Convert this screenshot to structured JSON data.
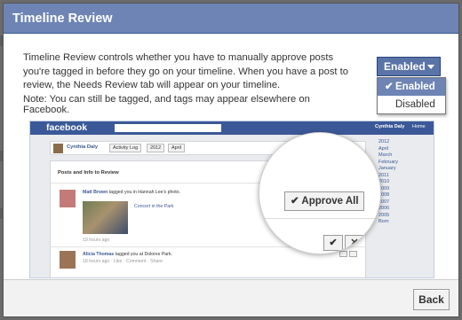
{
  "dialog": {
    "title": "Timeline Review",
    "description": "Timeline Review controls whether you have to manually approve posts you're tagged in before they go on your timeline. When you have a post to review, the Needs Review tab will appear on your timeline.",
    "note": "Note: You can still be tagged, and tags may appear elsewhere on Facebook.",
    "back_label": "Back"
  },
  "dropdown": {
    "selected": "Enabled",
    "options": [
      "Enabled",
      "Disabled"
    ],
    "check_glyph": "✔"
  },
  "screenshot": {
    "logo": "facebook",
    "user": "Cynthia Daly",
    "home": "Home",
    "timeline_name": "Cynthia Daly",
    "activity_log": "Activity Log",
    "year": "2012",
    "month": "April",
    "side_links": [
      "2012",
      "April",
      "March",
      "February",
      "January",
      "2011",
      "2010",
      "2009",
      "2008",
      "2007",
      "2006",
      "2005",
      "Born"
    ],
    "panel_title": "Posts and Info to Review",
    "row1_name": "Matt Brown",
    "row1_text": "tagged you in Hannah Lee's photo.",
    "row1_link": "Concert in the Park",
    "row1_time": "19 hours ago",
    "row2_name": "Alicia Thomas",
    "row2_text": "tagged you at Dolores Park.",
    "row2_time": "18 hours ago · Like · Comment · Share"
  },
  "magnifier": {
    "approve_all": "Approve All",
    "approve_glyph": "✔",
    "check_glyph": "✔",
    "close_glyph": "✕"
  },
  "colors": {
    "titlebar": "#6d84b4",
    "facebook_blue": "#3b5998",
    "dropdown_button": "#5b74a8"
  }
}
